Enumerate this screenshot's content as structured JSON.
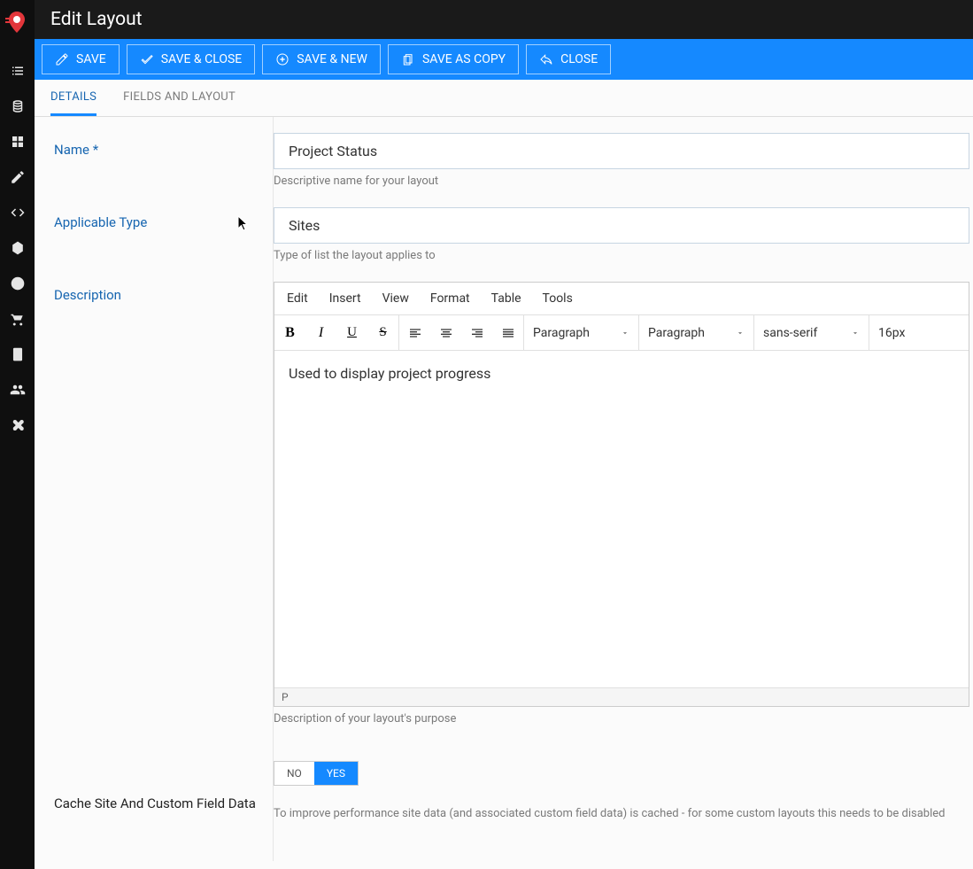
{
  "header": {
    "title": "Edit Layout"
  },
  "toolbar": {
    "save": "SAVE",
    "saveClose": "SAVE & CLOSE",
    "saveNew": "SAVE & NEW",
    "saveCopy": "SAVE AS COPY",
    "close": "CLOSE"
  },
  "tabs": {
    "details": "DETAILS",
    "fields": "FIELDS AND LAYOUT"
  },
  "form": {
    "name": {
      "label": "Name *",
      "value": "Project Status",
      "hint": "Descriptive name for your layout"
    },
    "type": {
      "label": "Applicable Type",
      "value": "Sites",
      "hint": "Type of list the layout applies to"
    },
    "desc": {
      "label": "Description",
      "menus": {
        "edit": "Edit",
        "insert": "Insert",
        "view": "View",
        "format": "Format",
        "table": "Table",
        "tools": "Tools"
      },
      "blockSel1": "Paragraph",
      "blockSel2": "Paragraph",
      "fontSel": "sans-serif",
      "sizeSel": "16px",
      "body": "Used to display project progress",
      "status": "P",
      "hint": "Description of your layout's purpose"
    },
    "cache": {
      "label": "Cache Site And Custom Field Data",
      "no": "NO",
      "yes": "YES",
      "hint": "To improve performance site data (and associated custom field data) is cached - for some custom layouts this needs to be disabled"
    }
  }
}
